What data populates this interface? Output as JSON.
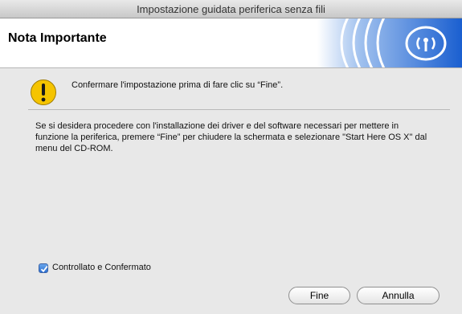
{
  "window": {
    "title": "Impostazione guidata periferica senza fili"
  },
  "header": {
    "title": "Nota Importante"
  },
  "notice": {
    "text": "Confermare l'impostazione prima di fare clic su “Fine”."
  },
  "body": {
    "text": "Se si desidera procedere con l'installazione dei driver e del software necessari per mettere in funzione la periferica, premere “Fine” per chiudere la schermata e selezionare \"Start Here OS X\" dal menu del CD-ROM."
  },
  "checkbox": {
    "label": "Controllato e Confermato",
    "checked": true
  },
  "buttons": {
    "finish": "Fine",
    "cancel": "Annulla"
  },
  "icons": {
    "warning": "warning-icon",
    "wireless": "wireless-logo-icon"
  },
  "colors": {
    "accent_blue": "#1a5fd0",
    "warning_yellow": "#f5c400"
  }
}
